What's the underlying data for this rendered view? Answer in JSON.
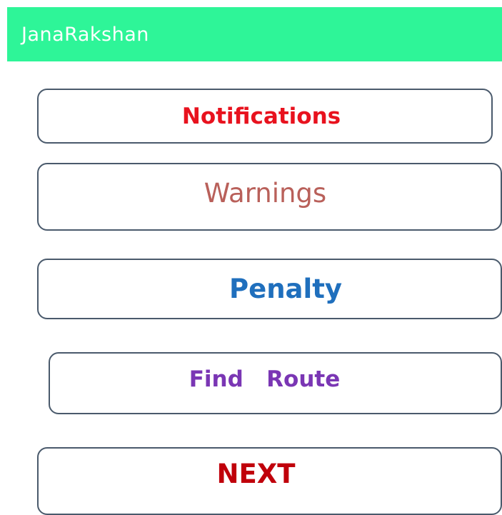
{
  "app_bar": {
    "title": "JanaRakshan",
    "background_color": "#2ef598",
    "title_color": "#ffffff"
  },
  "menu": {
    "notifications": {
      "label": "Notifications",
      "color": "#e8121e"
    },
    "warnings": {
      "label": "Warnings",
      "color": "#b9605a"
    },
    "penalty": {
      "label": "Penalty",
      "color": "#1f6fbd"
    },
    "find_route": {
      "label": "Find   Route",
      "color": "#7a36b4"
    },
    "next": {
      "label": "NEXT",
      "color": "#c0000b"
    }
  },
  "button_border_color": "#4a5a6c"
}
